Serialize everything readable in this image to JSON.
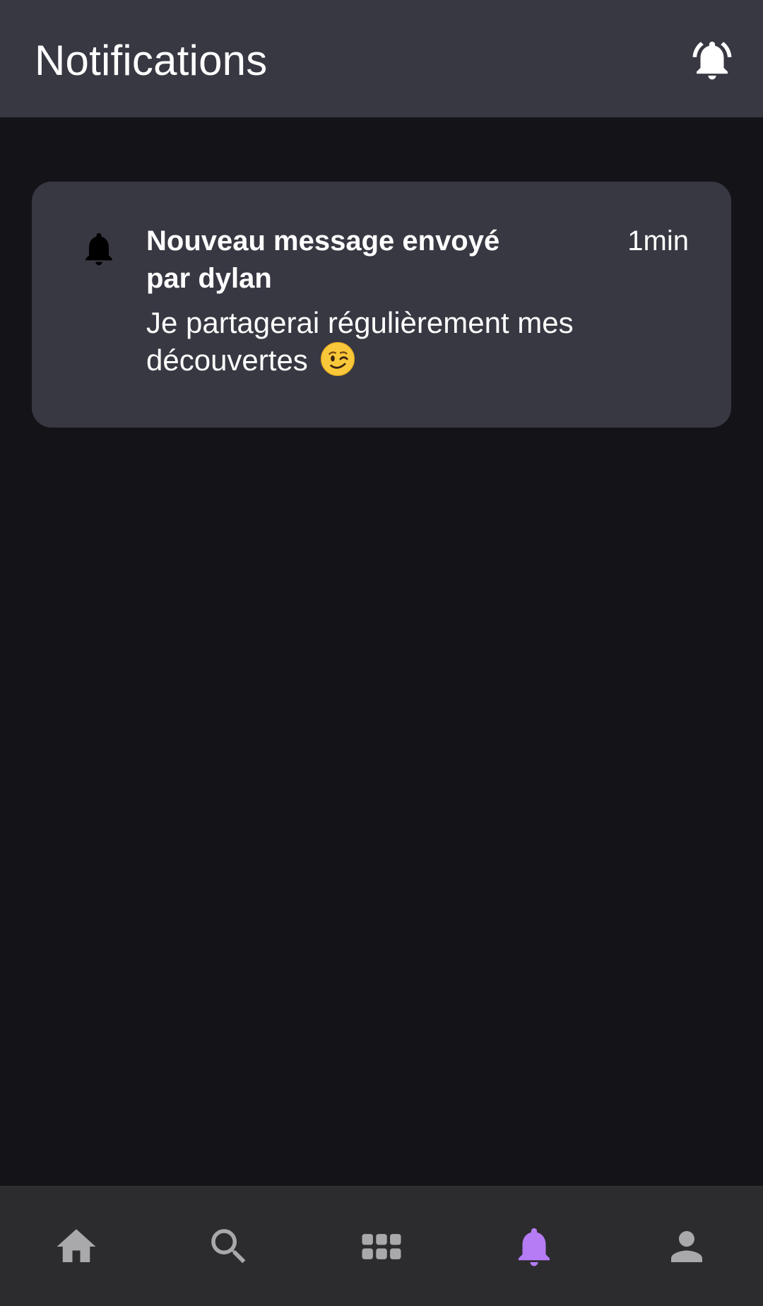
{
  "header": {
    "title": "Notifications",
    "bell_icon": "bell-ringing-icon"
  },
  "notifications": [
    {
      "icon": "bell-icon",
      "title": "Nouveau message envoyé par dylan",
      "time": "1min",
      "body": "Je partagerai régulièrement mes découvertes",
      "emoji": "winking-face-emoji"
    }
  ],
  "bottom_nav": {
    "items": [
      {
        "icon": "home-icon",
        "active": false
      },
      {
        "icon": "search-icon",
        "active": false
      },
      {
        "icon": "grid-icon",
        "active": false
      },
      {
        "icon": "bell-icon",
        "active": true
      },
      {
        "icon": "person-icon",
        "active": false
      }
    ]
  },
  "colors": {
    "background": "#141318",
    "header": "#383843",
    "card": "#383843",
    "nav_background": "#2c2c2e",
    "nav_inactive": "#a9a9ac",
    "nav_active": "#b57cf5"
  }
}
